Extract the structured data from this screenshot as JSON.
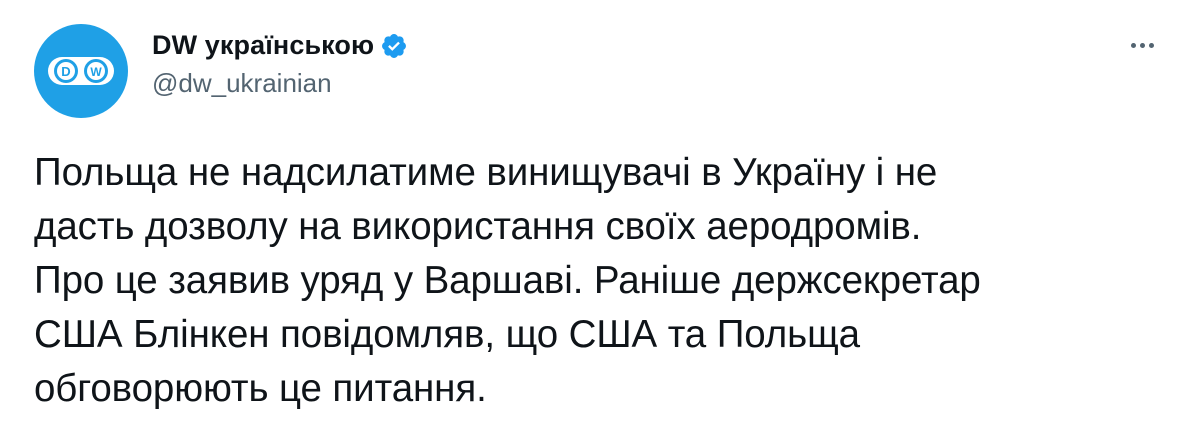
{
  "tweet": {
    "author": {
      "display_name": "DW українською",
      "handle": "@dw_ukrainian",
      "verified": true,
      "avatar_text": "DW",
      "avatar_color": "#1fa0e6"
    },
    "more_icon": "more-horizontal-icon",
    "verified_icon": "verified-badge-icon",
    "text_lines": [
      "Польща не надсилатиме винищувачі в Україну і не",
      "дасть дозволу на використання своїх аеродромів.",
      "Про це заявив уряд у Варшаві. Раніше держсекретар",
      "США Блінкен повідомляв, що США та Польща",
      "обговорюють це питання."
    ]
  },
  "colors": {
    "text": "#0f1419",
    "secondary": "#536471",
    "verified": "#1d9bf0"
  }
}
